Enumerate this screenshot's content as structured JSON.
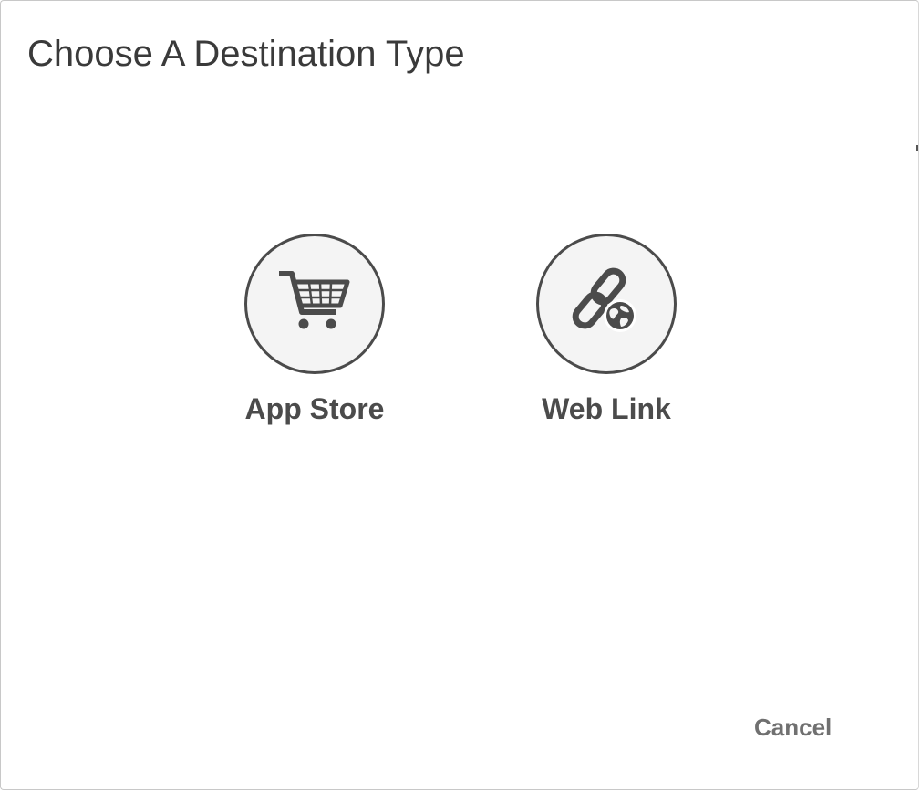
{
  "dialog": {
    "title": "Choose A Destination Type",
    "options": [
      {
        "label": "App Store",
        "icon": "shopping-cart-icon"
      },
      {
        "label": "Web Link",
        "icon": "link-globe-icon"
      }
    ],
    "cancel_label": "Cancel"
  },
  "colors": {
    "icon": "#4b4b4b",
    "circle_fill": "#f4f4f4",
    "title_text": "#3a3a3a",
    "cancel_text": "#707070"
  }
}
